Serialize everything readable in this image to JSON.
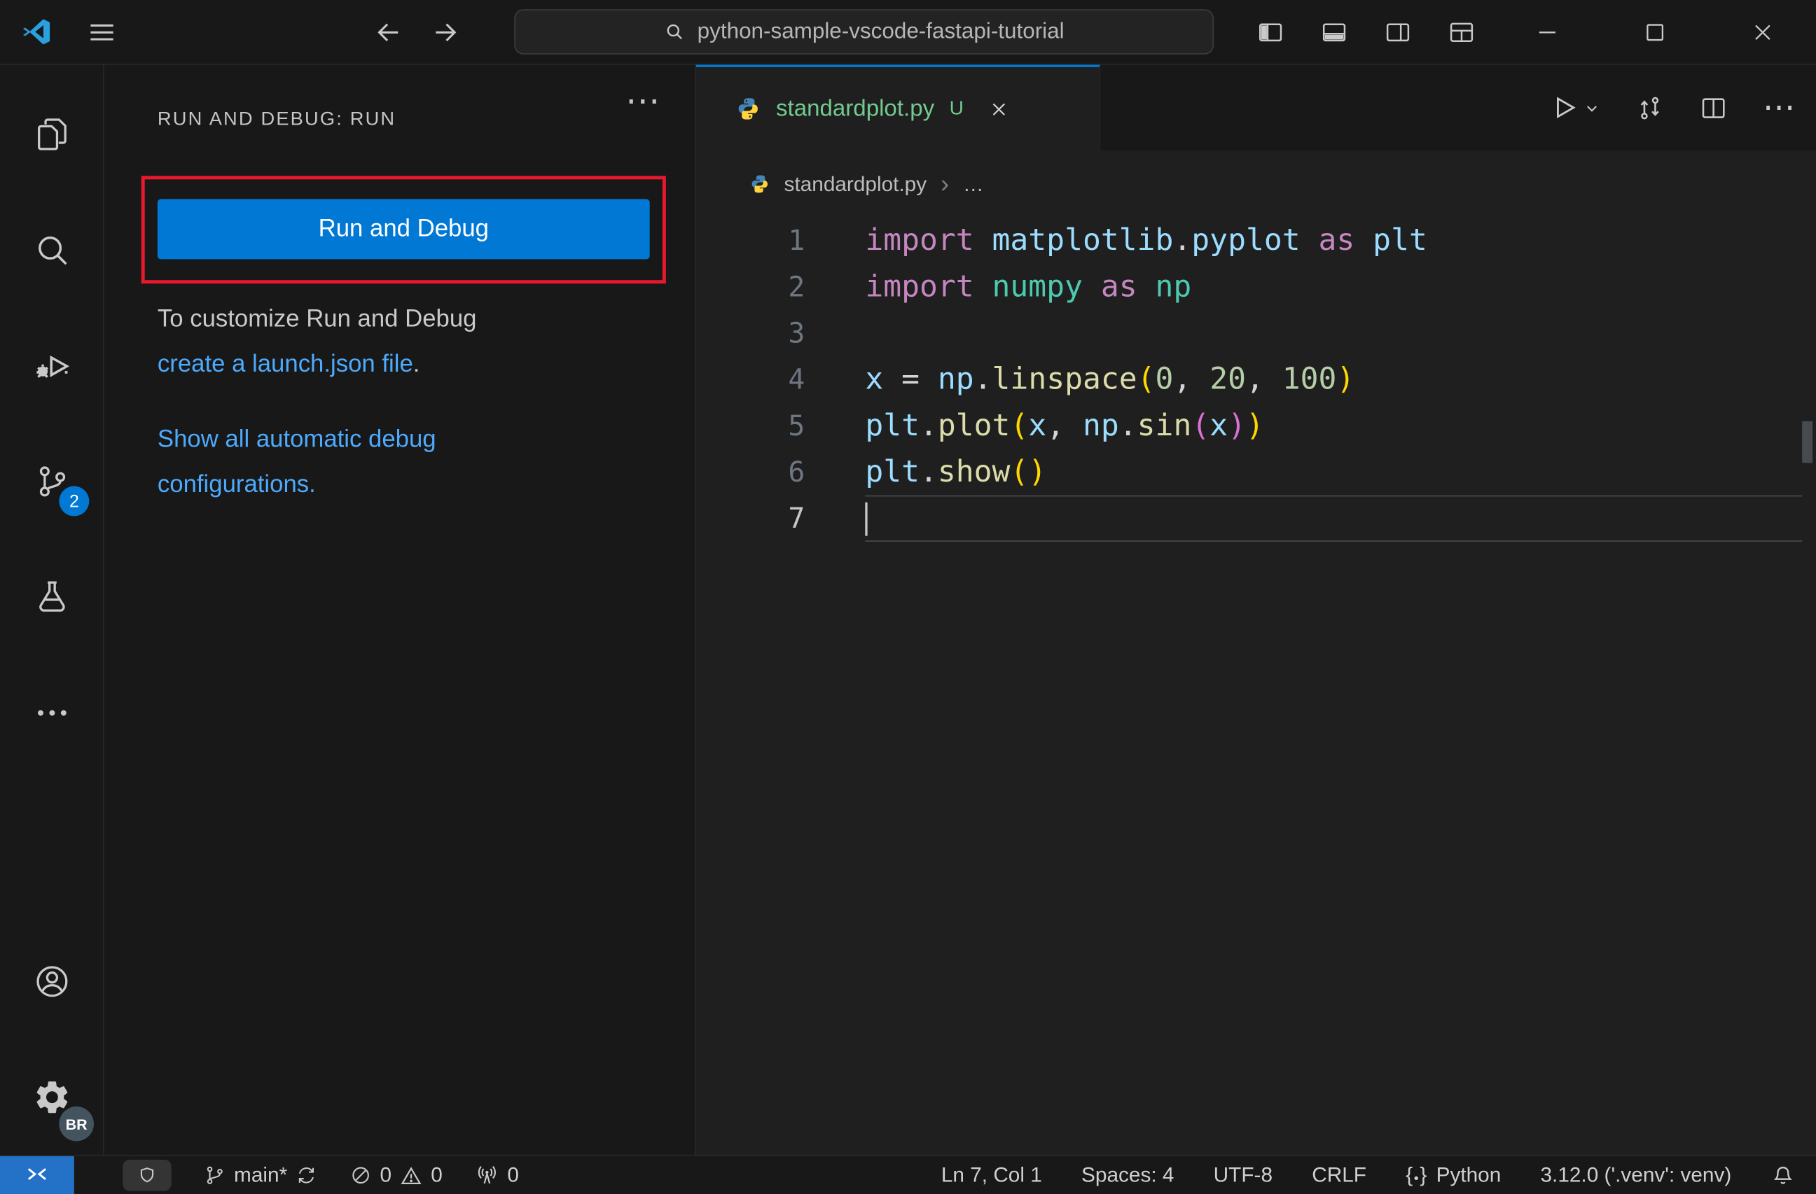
{
  "colors": {
    "accent": "#0078d4",
    "annotation_red": "#e8192c",
    "link_blue": "#4daafc",
    "untracked_green": "#73c991",
    "remote_blue": "#2472c8",
    "source_control_badge_blue": "#0078d4",
    "profile_badge_gray": "#44545f"
  },
  "titlebar": {
    "search_text": "python-sample-vscode-fastapi-tutorial"
  },
  "activity_bar": {
    "source_control_badge": "2",
    "profile_badge": "BR"
  },
  "sidebar": {
    "title": "RUN AND DEBUG: RUN",
    "run_button_label": "Run and Debug",
    "customize_line1": "To customize Run and Debug",
    "customize_link": "create a launch.json file",
    "customize_period": ".",
    "auto_config_link": "Show all automatic debug configurations",
    "auto_config_period": "."
  },
  "editor": {
    "tab": {
      "name": "standardplot.py",
      "git_status": "U"
    },
    "breadcrumb": {
      "file": "standardplot.py"
    },
    "code": {
      "token_colors": {
        "kw": "#C586C0",
        "mod": "#9CDCFE",
        "mod2": "#4EC9B0",
        "var": "#9CDCFE",
        "fn": "#DCDCAA",
        "num": "#B5CEA8",
        "pl": "#D4D4D4",
        "br1": "#FFD700",
        "br2": "#DA70D6"
      },
      "lines": [
        {
          "num": "1",
          "tokens": [
            [
              "import ",
              "kw"
            ],
            [
              "matplotlib",
              "mod"
            ],
            [
              ".",
              "pl"
            ],
            [
              "pyplot",
              "mod"
            ],
            [
              " ",
              "pl"
            ],
            [
              "as",
              "kw"
            ],
            [
              " ",
              "pl"
            ],
            [
              "plt",
              "mod"
            ]
          ]
        },
        {
          "num": "2",
          "tokens": [
            [
              "import ",
              "kw"
            ],
            [
              "numpy",
              "mod2"
            ],
            [
              " ",
              "pl"
            ],
            [
              "as",
              "kw"
            ],
            [
              " ",
              "pl"
            ],
            [
              "np",
              "mod2"
            ]
          ]
        },
        {
          "num": "3",
          "tokens": []
        },
        {
          "num": "4",
          "tokens": [
            [
              "x",
              "var"
            ],
            [
              " ",
              "pl"
            ],
            [
              "=",
              "pl"
            ],
            [
              " ",
              "pl"
            ],
            [
              "np",
              "var"
            ],
            [
              ".",
              "pl"
            ],
            [
              "linspace",
              "fn"
            ],
            [
              "(",
              "br1"
            ],
            [
              "0",
              "num"
            ],
            [
              ",",
              "pl"
            ],
            [
              " ",
              "pl"
            ],
            [
              "20",
              "num"
            ],
            [
              ",",
              "pl"
            ],
            [
              " ",
              "pl"
            ],
            [
              "100",
              "num"
            ],
            [
              ")",
              "br1"
            ]
          ]
        },
        {
          "num": "5",
          "tokens": [
            [
              "plt",
              "var"
            ],
            [
              ".",
              "pl"
            ],
            [
              "plot",
              "fn"
            ],
            [
              "(",
              "br1"
            ],
            [
              "x",
              "var"
            ],
            [
              ",",
              "pl"
            ],
            [
              " ",
              "pl"
            ],
            [
              "np",
              "var"
            ],
            [
              ".",
              "pl"
            ],
            [
              "sin",
              "fn"
            ],
            [
              "(",
              "br2"
            ],
            [
              "x",
              "var"
            ],
            [
              ")",
              "br2"
            ],
            [
              ")",
              "br1"
            ]
          ]
        },
        {
          "num": "6",
          "tokens": [
            [
              "plt",
              "var"
            ],
            [
              ".",
              "pl"
            ],
            [
              "show",
              "fn"
            ],
            [
              "(",
              "br1"
            ],
            [
              ")",
              "br1"
            ]
          ]
        },
        {
          "num": "7",
          "tokens": [],
          "current": true
        }
      ]
    }
  },
  "status_bar": {
    "branch": "main*",
    "errors": "0",
    "warnings": "0",
    "ports": "0",
    "cursor_position": "Ln 7, Col 1",
    "indentation": "Spaces: 4",
    "encoding": "UTF-8",
    "eol": "CRLF",
    "language": "Python",
    "interpreter": "3.12.0 ('.venv': venv)"
  },
  "icons": {
    "ellipsis": "⋯",
    "breadcrumb_ellipsis": "…",
    "chevron_right": "›",
    "brace_open": "{",
    "brace_close": "}",
    "dot": "•"
  }
}
